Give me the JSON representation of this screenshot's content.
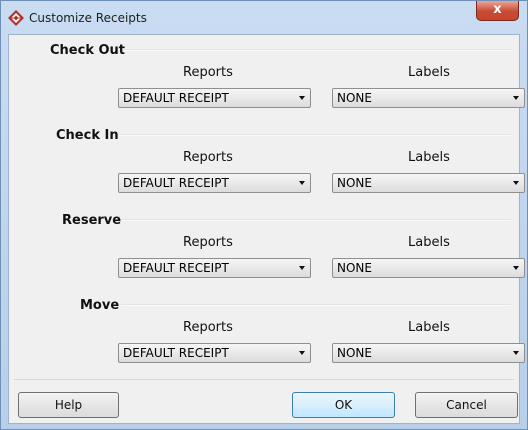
{
  "window": {
    "title": "Customize Receipts",
    "close_label": "x"
  },
  "sections": [
    {
      "title": "Check Out",
      "reports_header": "Reports",
      "labels_header": "Labels",
      "reports_value": "DEFAULT RECEIPT",
      "labels_value": "NONE"
    },
    {
      "title": "Check In",
      "reports_header": "Reports",
      "labels_header": "Labels",
      "reports_value": "DEFAULT RECEIPT",
      "labels_value": "NONE"
    },
    {
      "title": "Reserve",
      "reports_header": "Reports",
      "labels_header": "Labels",
      "reports_value": "DEFAULT RECEIPT",
      "labels_value": "NONE"
    },
    {
      "title": "Move",
      "reports_header": "Reports",
      "labels_header": "Labels",
      "reports_value": "DEFAULT RECEIPT",
      "labels_value": "NONE"
    }
  ],
  "buttons": {
    "help": "Help",
    "ok": "OK",
    "cancel": "Cancel"
  },
  "colors": {
    "titlebar": "#c9dcf2",
    "close_button": "#c94a34",
    "dialog_background": "#f0f0f0",
    "default_button_border": "#3c7fb1"
  },
  "icons": {
    "app": "diamond-logo-icon",
    "close": "close-icon",
    "dropdown": "chevron-down-icon"
  }
}
